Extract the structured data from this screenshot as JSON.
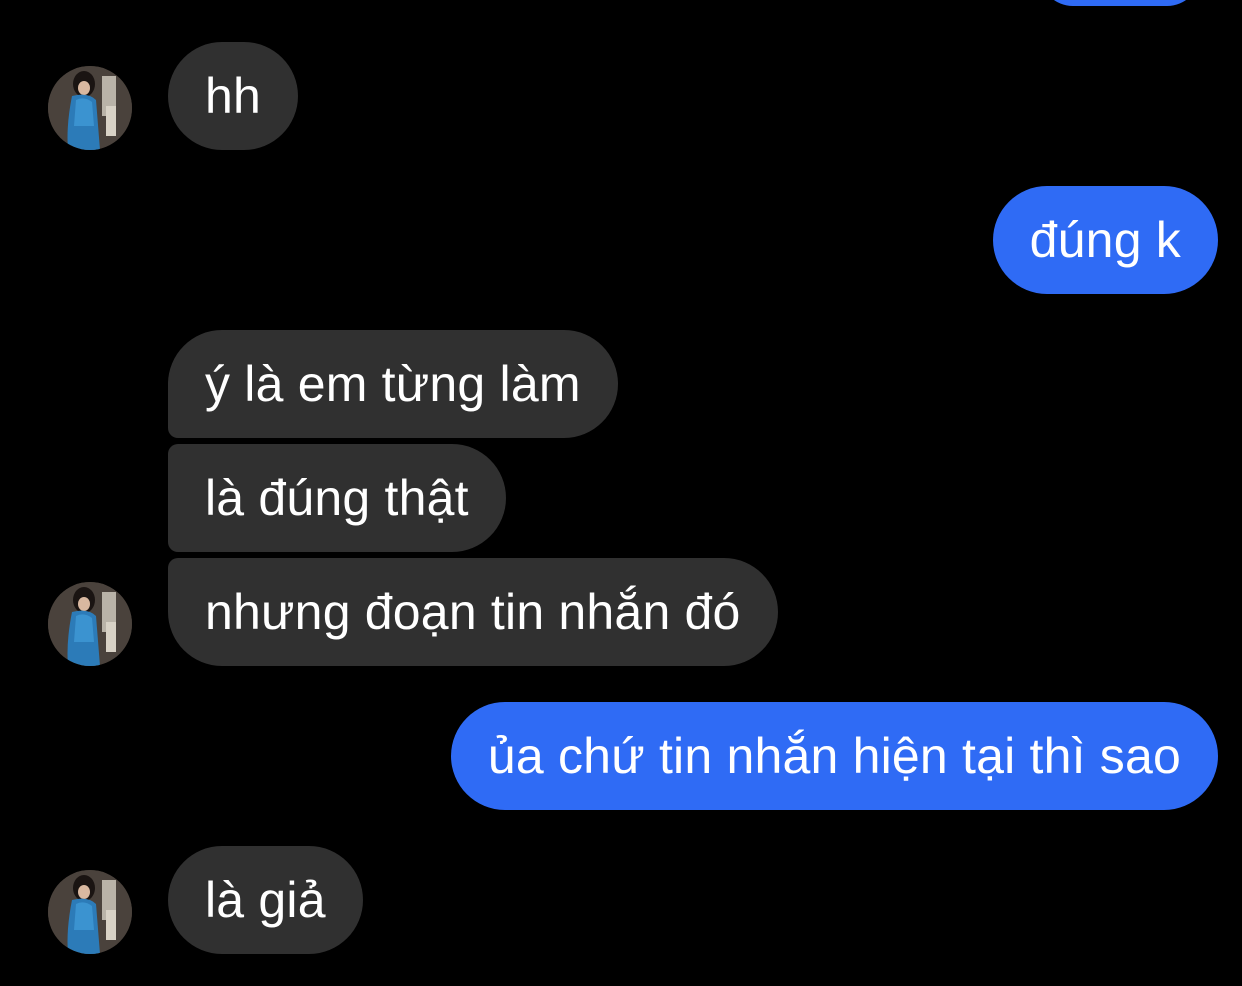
{
  "conversation": {
    "colors": {
      "background": "#000000",
      "incoming_bubble": "#303030",
      "outgoing_bubble": "#2f6bf5",
      "text": "#ffffff"
    },
    "messages": [
      {
        "direction": "incoming",
        "text": "hh"
      },
      {
        "direction": "outgoing",
        "text": "đúng k"
      },
      {
        "direction": "incoming",
        "text": "ý là em từng làm"
      },
      {
        "direction": "incoming",
        "text": "là đúng thật"
      },
      {
        "direction": "incoming",
        "text": "nhưng đoạn tin nhắn đó"
      },
      {
        "direction": "outgoing",
        "text": "ủa chứ tin nhắn hiện tại thì sao"
      },
      {
        "direction": "incoming",
        "text": "là giả"
      }
    ],
    "avatar_icon": "contact-avatar-photo"
  }
}
